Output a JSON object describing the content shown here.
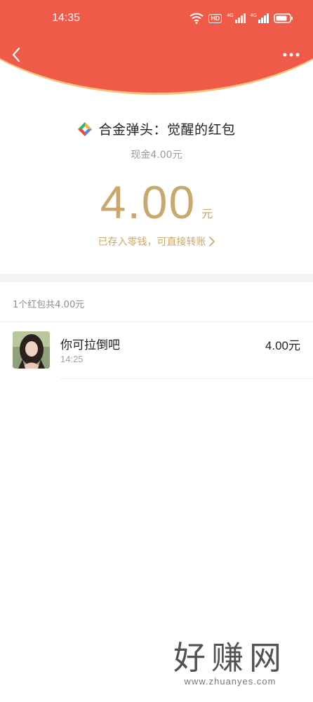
{
  "status_bar": {
    "time": "14:35",
    "hd_label": "HD",
    "signal1": "4G",
    "signal2": "4G"
  },
  "header": {
    "bg_color": "#f05a48"
  },
  "title": {
    "text": "合金弹头：觉醒的红包",
    "subtitle": "现金4.00元"
  },
  "amount": {
    "value": "4.00",
    "unit": "元",
    "color": "#c9a76d"
  },
  "deposit_link": {
    "label": "已存入零钱，可直接转账"
  },
  "summary": {
    "text": "1个红包共4.00元"
  },
  "records": [
    {
      "name": "你可拉倒吧",
      "time": "14:25",
      "amount": "4.00元"
    }
  ],
  "watermark": {
    "big": "好赚网",
    "small": "www.zhuanyes.com"
  },
  "icons": {
    "back": "chevron-left-icon",
    "more": "more-dots-icon",
    "wifi": "wifi-icon",
    "battery": "battery-icon",
    "app_logo": "app-logo-icon"
  }
}
